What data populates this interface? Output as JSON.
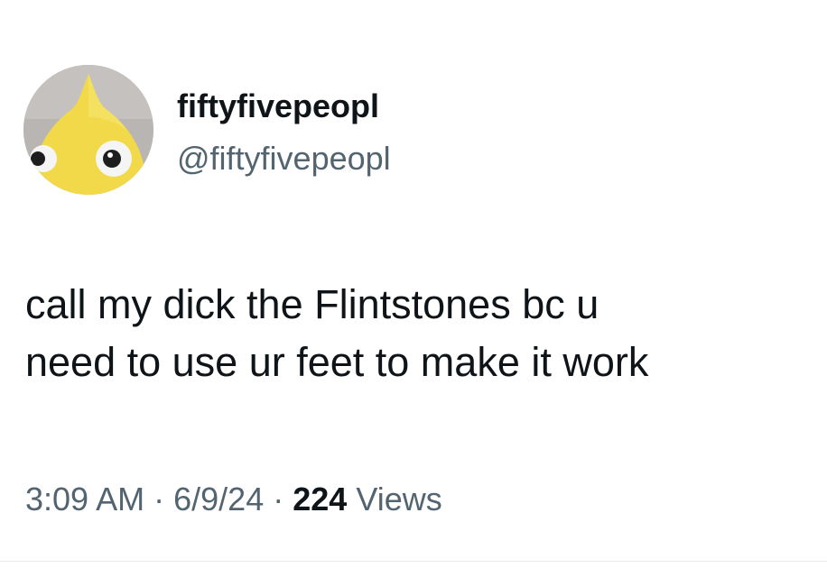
{
  "author": {
    "display_name": "fiftyfivepeopl",
    "handle": "@fiftyfivepeopl",
    "avatar_icon": "yellow-plush-creature-avatar"
  },
  "tweet": {
    "text_lines": [
      "call my dick the Flintstones bc u",
      "need to use ur feet to make it work"
    ]
  },
  "meta": {
    "time": "3:09 AM",
    "separator": "·",
    "date": "6/9/24",
    "views_count": "224",
    "views_label": "Views"
  },
  "colors": {
    "text_primary": "#0f1419",
    "text_secondary": "#536471",
    "divider": "#e7e9ea",
    "avatar_yellow": "#f2d94a"
  }
}
